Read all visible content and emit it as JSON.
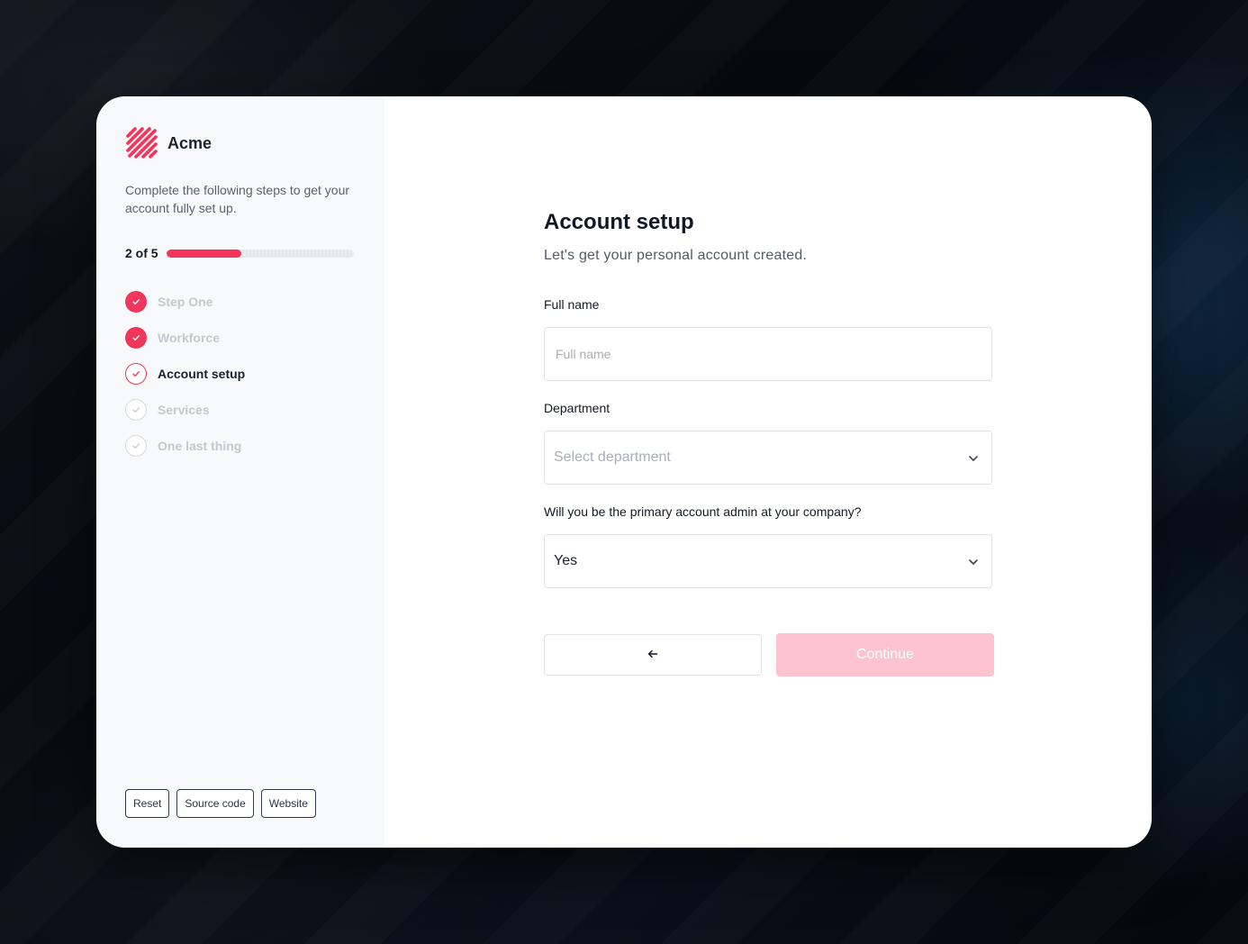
{
  "brand": {
    "name": "Acme",
    "accent_color": "#f0365a",
    "logo_icon": "acme-stripes-icon"
  },
  "sidebar": {
    "intro": "Complete the following steps to get your account fully set up.",
    "progress": {
      "label": "2 of 5",
      "completed": 2,
      "total": 5
    },
    "steps": [
      {
        "label": "Step One",
        "state": "done"
      },
      {
        "label": "Workforce",
        "state": "done"
      },
      {
        "label": "Account setup",
        "state": "current"
      },
      {
        "label": "Services",
        "state": "todo"
      },
      {
        "label": "One last thing",
        "state": "todo"
      }
    ],
    "footer_links": [
      {
        "label": "Reset"
      },
      {
        "label": "Source code"
      },
      {
        "label": "Website"
      }
    ]
  },
  "form": {
    "title": "Account setup",
    "subtitle": "Let's get your personal account created.",
    "full_name": {
      "label": "Full name",
      "placeholder": "Full name",
      "value": ""
    },
    "department": {
      "label": "Department",
      "placeholder": "Select department",
      "value": ""
    },
    "primary_admin": {
      "label": "Will you be the primary account admin at your company?",
      "value": "Yes"
    },
    "back_icon": "arrow-left-icon",
    "continue_label": "Continue",
    "continue_disabled_color": "#fdc3cf"
  }
}
